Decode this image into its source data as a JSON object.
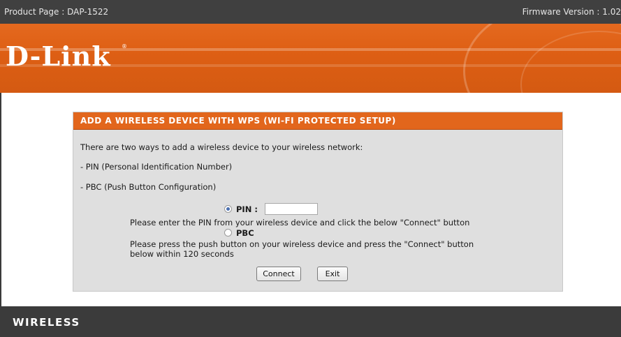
{
  "topbar": {
    "product_page": "Product Page : DAP-1522",
    "firmware": "Firmware Version : 1.02"
  },
  "header": {
    "logo": "D-Link",
    "registered": "®"
  },
  "wps": {
    "title": "ADD A WIRELESS DEVICE WITH WPS (WI-FI PROTECTED SETUP)",
    "intro": "There are two ways to add a wireless device to your wireless network:",
    "method_pin": "- PIN (Personal Identification Number)",
    "method_pbc": "- PBC (Push Button Configuration)",
    "pin_label": "PIN :",
    "pin_value": "",
    "pin_selected": true,
    "pin_help": "Please enter the PIN from your wireless device and click the below \"Connect\" button",
    "pbc_label": "PBC",
    "pbc_help_line1": "Please press the push button on your wireless device and press the \"Connect\" button",
    "pbc_help_line2": "below within 120 seconds",
    "connect_label": "Connect",
    "exit_label": "Exit"
  },
  "footer": {
    "label": "WIRELESS"
  },
  "colors": {
    "accent_orange": "#e2661c",
    "dark_bar": "#3b3b3b",
    "panel_bg": "#dfdfdf"
  }
}
